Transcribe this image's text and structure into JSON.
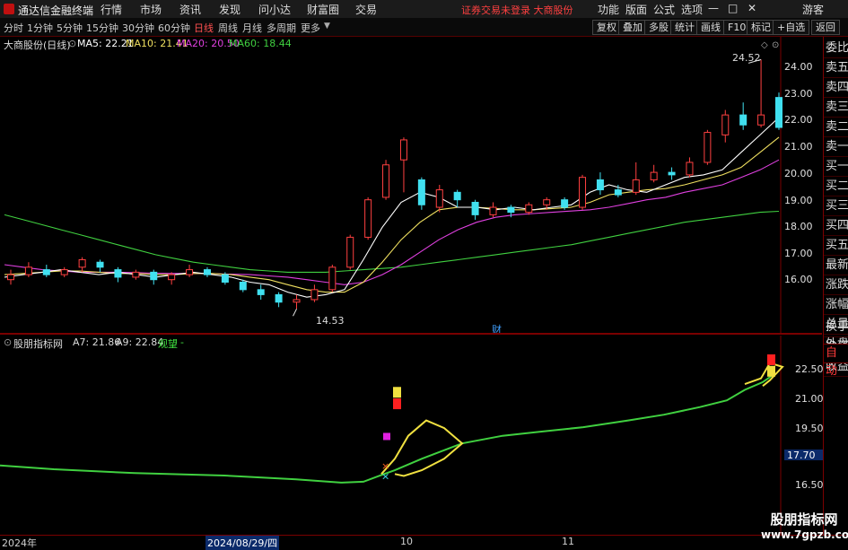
{
  "menubar": {
    "app_title": "通达信金融终端",
    "items": [
      "行情",
      "市场",
      "资讯",
      "发现",
      "问小达",
      "财富圈",
      "交易"
    ],
    "notice": "证券交易未登录  大商股份",
    "right_items": [
      "功能",
      "版面",
      "公式",
      "选项"
    ],
    "guest": "游客",
    "window_buttons": [
      "—",
      "□",
      "✕"
    ]
  },
  "toolbar": {
    "periods": [
      "分时",
      "1分钟",
      "5分钟",
      "15分钟",
      "30分钟",
      "60分钟",
      "日线",
      "周线",
      "月线",
      "多周期",
      "更多"
    ],
    "active_period": "日线",
    "buttons": [
      "复权",
      "叠加",
      "多股",
      "统计",
      "画线",
      "F10",
      "标记",
      "+自选",
      "返回"
    ]
  },
  "main_chart": {
    "stock_label": "大商股份(日线)",
    "ma": [
      {
        "text": "MA5: 22.21",
        "color": "#ffffff"
      },
      {
        "text": "MA10: 21.41",
        "color": "#f0e060"
      },
      {
        "text": "MA20: 20.50",
        "color": "#e040e0"
      },
      {
        "text": "MA60: 18.44",
        "color": "#40d040"
      }
    ],
    "y_ticks": [
      "24.00",
      "23.00",
      "22.00",
      "21.00",
      "20.00",
      "19.00",
      "18.00",
      "17.00",
      "16.00"
    ],
    "high_label": "24.52",
    "low_label": "14.53",
    "fin_marker": "财"
  },
  "indicator": {
    "name": "股朋指标网",
    "a7": "A7: 21.86",
    "a9": "A9: 22.84",
    "signal": "观望",
    "signal_suffix": "-",
    "y_ticks": [
      "22.50",
      "21.00",
      "19.50",
      "18.00",
      "16.50"
    ],
    "current_value": "17.70"
  },
  "sidebar": {
    "items": [
      "委比",
      "卖五",
      "卖四",
      "卖三",
      "卖二",
      "卖一",
      "买一",
      "买二",
      "买三",
      "买四",
      "买五",
      "最新",
      "涨跌",
      "涨幅",
      "总量",
      "外盘",
      "换手",
      "净资",
      "收益"
    ],
    "auto": "自动"
  },
  "timebar": {
    "labels": [
      "2024年",
      "2024/08/29/四",
      "10",
      "11"
    ]
  },
  "watermark": {
    "name": "股朋指标网",
    "url": "www.7gpzb.com"
  },
  "colors": {
    "up": "#ff4040",
    "down": "#40e0f0",
    "frame": "#7a0000"
  },
  "chart_data": {
    "type": "line",
    "title": "",
    "xlabel": "",
    "ylabel": "",
    "ylim": [
      14.0,
      25.0
    ],
    "x_ticks": [
      "2024/08/29/四",
      "10",
      "11"
    ],
    "series": [
      {
        "name": "MA5",
        "values": [
          15.8,
          15.9,
          16.0,
          16.1,
          16.0,
          15.9,
          16.0,
          15.9,
          15.8,
          15.9,
          16.0,
          15.9,
          15.8,
          15.6,
          15.5,
          15.2,
          15.0,
          15.1,
          15.3,
          16.5,
          17.8,
          18.8,
          19.2,
          19.0,
          18.6,
          18.6,
          18.5,
          18.6,
          18.5,
          18.6,
          18.7,
          19.2,
          19.5,
          19.3,
          19.2,
          19.5,
          19.8,
          19.9,
          20.1,
          20.8,
          21.5,
          22.2
        ]
      },
      {
        "name": "MA10",
        "values": [
          15.9,
          15.95,
          16.0,
          16.05,
          16.05,
          16.0,
          15.95,
          15.95,
          15.9,
          15.9,
          15.95,
          15.95,
          15.9,
          15.8,
          15.7,
          15.5,
          15.3,
          15.2,
          15.2,
          15.6,
          16.4,
          17.3,
          18.0,
          18.5,
          18.6,
          18.6,
          18.55,
          18.5,
          18.5,
          18.55,
          18.6,
          18.8,
          19.1,
          19.2,
          19.3,
          19.35,
          19.5,
          19.7,
          19.9,
          20.2,
          20.8,
          21.41
        ]
      },
      {
        "name": "MA20",
        "values": [
          16.3,
          16.2,
          16.1,
          16.05,
          16.0,
          16.0,
          16.0,
          15.98,
          15.96,
          15.95,
          15.95,
          15.94,
          15.92,
          15.9,
          15.85,
          15.8,
          15.7,
          15.6,
          15.5,
          15.6,
          15.9,
          16.3,
          16.8,
          17.3,
          17.7,
          18.0,
          18.2,
          18.3,
          18.35,
          18.4,
          18.45,
          18.5,
          18.6,
          18.75,
          18.9,
          19.0,
          19.2,
          19.35,
          19.5,
          19.8,
          20.1,
          20.5
        ]
      },
      {
        "name": "MA60",
        "values": [
          18.3,
          18.1,
          17.9,
          17.7,
          17.5,
          17.3,
          17.1,
          16.9,
          16.7,
          16.55,
          16.4,
          16.3,
          16.2,
          16.1,
          16.05,
          16.0,
          16.0,
          16.0,
          16.05,
          16.1,
          16.15,
          16.2,
          16.3,
          16.4,
          16.5,
          16.6,
          16.7,
          16.8,
          16.9,
          17.0,
          17.1,
          17.25,
          17.4,
          17.55,
          17.7,
          17.85,
          18.0,
          18.1,
          18.2,
          18.3,
          18.4,
          18.44
        ]
      }
    ],
    "candles": [
      {
        "o": 15.7,
        "c": 15.9,
        "h": 16.1,
        "l": 15.5
      },
      {
        "o": 15.9,
        "c": 16.2,
        "h": 16.4,
        "l": 15.8
      },
      {
        "o": 16.1,
        "c": 15.9,
        "h": 16.3,
        "l": 15.8
      },
      {
        "o": 15.9,
        "c": 16.1,
        "h": 16.2,
        "l": 15.8
      },
      {
        "o": 16.2,
        "c": 16.5,
        "h": 16.6,
        "l": 16.0
      },
      {
        "o": 16.4,
        "c": 16.2,
        "h": 16.5,
        "l": 16.0
      },
      {
        "o": 16.1,
        "c": 15.8,
        "h": 16.2,
        "l": 15.6
      },
      {
        "o": 15.8,
        "c": 16.0,
        "h": 16.1,
        "l": 15.7
      },
      {
        "o": 16.0,
        "c": 15.7,
        "h": 16.1,
        "l": 15.5
      },
      {
        "o": 15.7,
        "c": 15.9,
        "h": 16.0,
        "l": 15.5
      },
      {
        "o": 15.9,
        "c": 16.1,
        "h": 16.3,
        "l": 15.8
      },
      {
        "o": 16.1,
        "c": 15.9,
        "h": 16.2,
        "l": 15.8
      },
      {
        "o": 15.9,
        "c": 15.6,
        "h": 16.0,
        "l": 15.5
      },
      {
        "o": 15.6,
        "c": 15.3,
        "h": 15.7,
        "l": 15.2
      },
      {
        "o": 15.3,
        "c": 15.1,
        "h": 15.5,
        "l": 14.9
      },
      {
        "o": 15.1,
        "c": 14.8,
        "h": 15.2,
        "l": 14.6
      },
      {
        "o": 14.8,
        "c": 14.9,
        "h": 15.1,
        "l": 14.53
      },
      {
        "o": 14.9,
        "c": 15.3,
        "h": 15.5,
        "l": 14.8
      },
      {
        "o": 15.3,
        "c": 16.2,
        "h": 16.3,
        "l": 15.2
      },
      {
        "o": 16.2,
        "c": 17.4,
        "h": 17.5,
        "l": 16.1
      },
      {
        "o": 17.4,
        "c": 18.9,
        "h": 19.0,
        "l": 17.3
      },
      {
        "o": 19.0,
        "c": 20.3,
        "h": 20.5,
        "l": 18.9
      },
      {
        "o": 20.5,
        "c": 21.3,
        "h": 21.4,
        "l": 19.2
      },
      {
        "o": 19.7,
        "c": 18.7,
        "h": 19.8,
        "l": 18.5
      },
      {
        "o": 18.6,
        "c": 19.3,
        "h": 19.5,
        "l": 18.4
      },
      {
        "o": 19.2,
        "c": 18.9,
        "h": 19.3,
        "l": 18.6
      },
      {
        "o": 18.8,
        "c": 18.3,
        "h": 18.9,
        "l": 18.1
      },
      {
        "o": 18.3,
        "c": 18.6,
        "h": 18.8,
        "l": 18.2
      },
      {
        "o": 18.6,
        "c": 18.4,
        "h": 18.7,
        "l": 18.2
      },
      {
        "o": 18.4,
        "c": 18.7,
        "h": 18.8,
        "l": 18.3
      },
      {
        "o": 18.7,
        "c": 18.9,
        "h": 19.0,
        "l": 18.5
      },
      {
        "o": 18.9,
        "c": 18.6,
        "h": 19.0,
        "l": 18.5
      },
      {
        "o": 18.6,
        "c": 19.8,
        "h": 19.9,
        "l": 18.5
      },
      {
        "o": 19.7,
        "c": 19.3,
        "h": 20.0,
        "l": 19.1
      },
      {
        "o": 19.3,
        "c": 19.1,
        "h": 19.5,
        "l": 19.0
      },
      {
        "o": 19.2,
        "c": 19.7,
        "h": 20.4,
        "l": 19.1
      },
      {
        "o": 19.7,
        "c": 20.0,
        "h": 20.3,
        "l": 19.6
      },
      {
        "o": 20.0,
        "c": 19.9,
        "h": 20.2,
        "l": 19.7
      },
      {
        "o": 19.9,
        "c": 20.4,
        "h": 20.6,
        "l": 19.8
      },
      {
        "o": 20.4,
        "c": 21.6,
        "h": 21.7,
        "l": 20.3
      },
      {
        "o": 21.5,
        "c": 22.3,
        "h": 22.5,
        "l": 21.2
      },
      {
        "o": 22.3,
        "c": 21.9,
        "h": 22.8,
        "l": 21.7
      },
      {
        "o": 21.9,
        "c": 22.3,
        "h": 24.52,
        "l": 21.8
      },
      {
        "o": 23.0,
        "c": 21.8,
        "h": 23.2,
        "l": 21.7
      }
    ]
  }
}
